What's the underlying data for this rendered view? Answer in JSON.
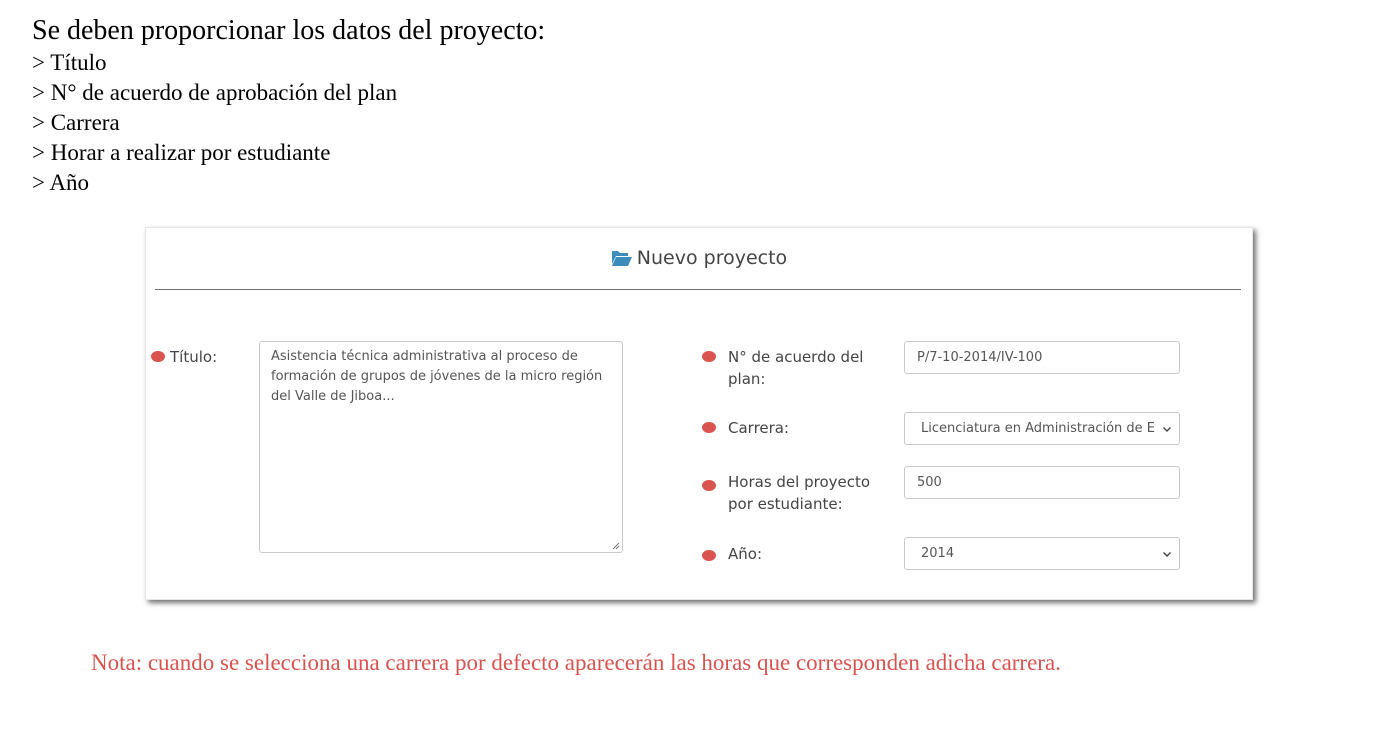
{
  "intro": {
    "title": "Se deben proporcionar los datos del proyecto:",
    "items": [
      "> Título",
      "> N° de acuerdo de aprobación del plan",
      "> Carrera",
      "> Horar a realizar por estudiante",
      "> Año"
    ]
  },
  "form": {
    "header_icon": "folder-open-icon",
    "title": "Nuevo proyecto",
    "titulo": {
      "label": "Título:",
      "value": "Asistencia técnica administrativa al proceso de formación de grupos de jóvenes de la micro región del Valle de Jiboa..."
    },
    "acuerdo": {
      "label": "N° de acuerdo del plan:",
      "value": "P/7-10-2014/IV-100"
    },
    "carrera": {
      "label": "Carrera:",
      "value": "Licenciatura en Administración de E"
    },
    "horas": {
      "label": "Horas del proyecto por estudiante:",
      "value": "500"
    },
    "anio": {
      "label": "Año:",
      "value": "2014"
    }
  },
  "note": "Nota: cuando se selecciona una carrera por defecto aparecerán las horas que corresponden adicha carrera.",
  "colors": {
    "required_dot": "#d9534f",
    "icon_blue": "#3c8dbc",
    "note_red": "#d9534f"
  }
}
